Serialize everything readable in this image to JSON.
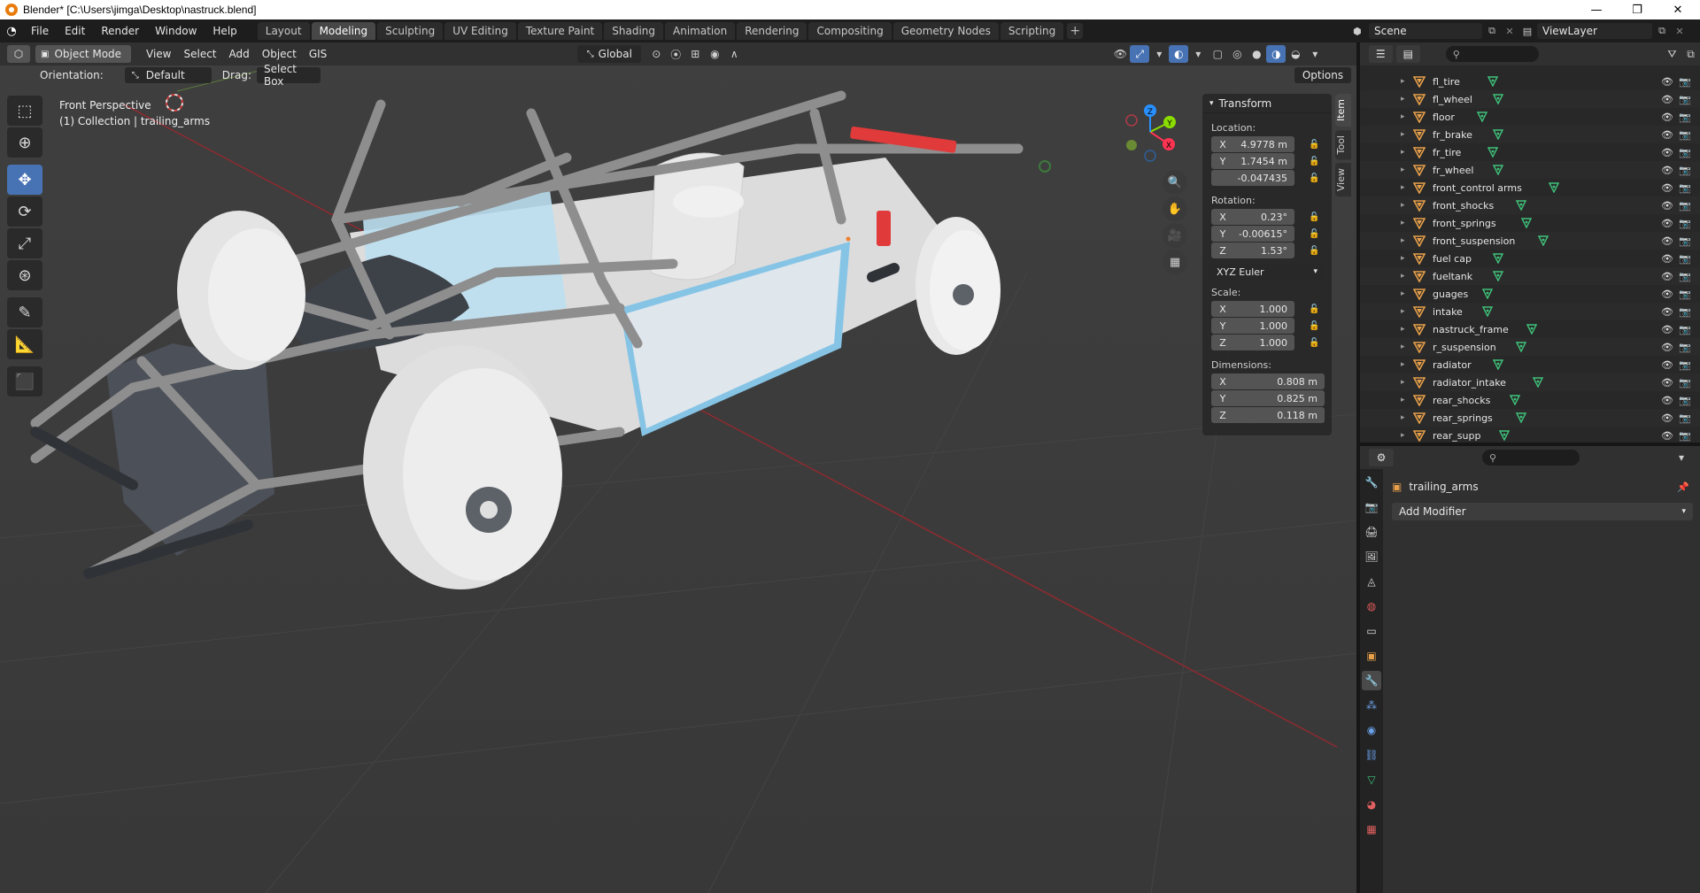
{
  "window": {
    "title": "Blender* [C:\\Users\\jimga\\Desktop\\nastruck.blend]",
    "minimize": "—",
    "maximize": "❐",
    "close": "✕"
  },
  "menus": [
    "File",
    "Edit",
    "Render",
    "Window",
    "Help"
  ],
  "workspaces": [
    "Layout",
    "Modeling",
    "Sculpting",
    "UV Editing",
    "Texture Paint",
    "Shading",
    "Animation",
    "Rendering",
    "Compositing",
    "Geometry Nodes",
    "Scripting"
  ],
  "active_workspace": "Modeling",
  "scene": {
    "name": "Scene",
    "view_layer": "ViewLayer"
  },
  "viewport_header": {
    "mode": "Object Mode",
    "menus": [
      "View",
      "Select",
      "Add",
      "Object",
      "GIS"
    ],
    "transform_orientation": "Global",
    "options": "Options"
  },
  "tool_settings": {
    "orientation_label": "Orientation:",
    "orientation_value": "Default",
    "drag_label": "Drag:",
    "drag_value": "Select Box"
  },
  "overlay_text": {
    "view": "Front Perspective",
    "collection": "(1) Collection | trailing_arms"
  },
  "transform_panel": {
    "title": "Transform",
    "location_label": "Location:",
    "location": {
      "x": "4.9778 m",
      "y": "1.7454 m",
      "z": "-0.047435"
    },
    "rotation_label": "Rotation:",
    "rotation": {
      "x": "0.23°",
      "y": "-0.00615°",
      "z": "1.53°"
    },
    "rotation_mode": "XYZ Euler",
    "scale_label": "Scale:",
    "scale": {
      "x": "1.000",
      "y": "1.000",
      "z": "1.000"
    },
    "dimensions_label": "Dimensions:",
    "dimensions": {
      "x": "0.808 m",
      "y": "0.825 m",
      "z": "0.118 m"
    }
  },
  "sidebar_tabs": [
    "Item",
    "Tool",
    "View"
  ],
  "gizmo": {
    "x": "X",
    "y": "Y",
    "z": "Z"
  },
  "outliner_items": [
    "fl_tire",
    "fl_wheel",
    "floor",
    "fr_brake",
    "fr_tire",
    "fr_wheel",
    "front_control arms",
    "front_shocks",
    "front_springs",
    "front_suspension",
    "fuel cap",
    "fueltank",
    "guages",
    "intake",
    "nastruck_frame",
    "r_suspension",
    "radiator",
    "radiator_intake",
    "rear_shocks",
    "rear_springs",
    "rear_supp"
  ],
  "properties": {
    "object_name": "trailing_arms",
    "add_modifier": "Add Modifier"
  },
  "colors": {
    "accent": "#4772b3",
    "x_axis": "#ff3352",
    "y_axis": "#8bdc00",
    "z_axis": "#2890ff",
    "object_icon": "#e8a04a"
  }
}
